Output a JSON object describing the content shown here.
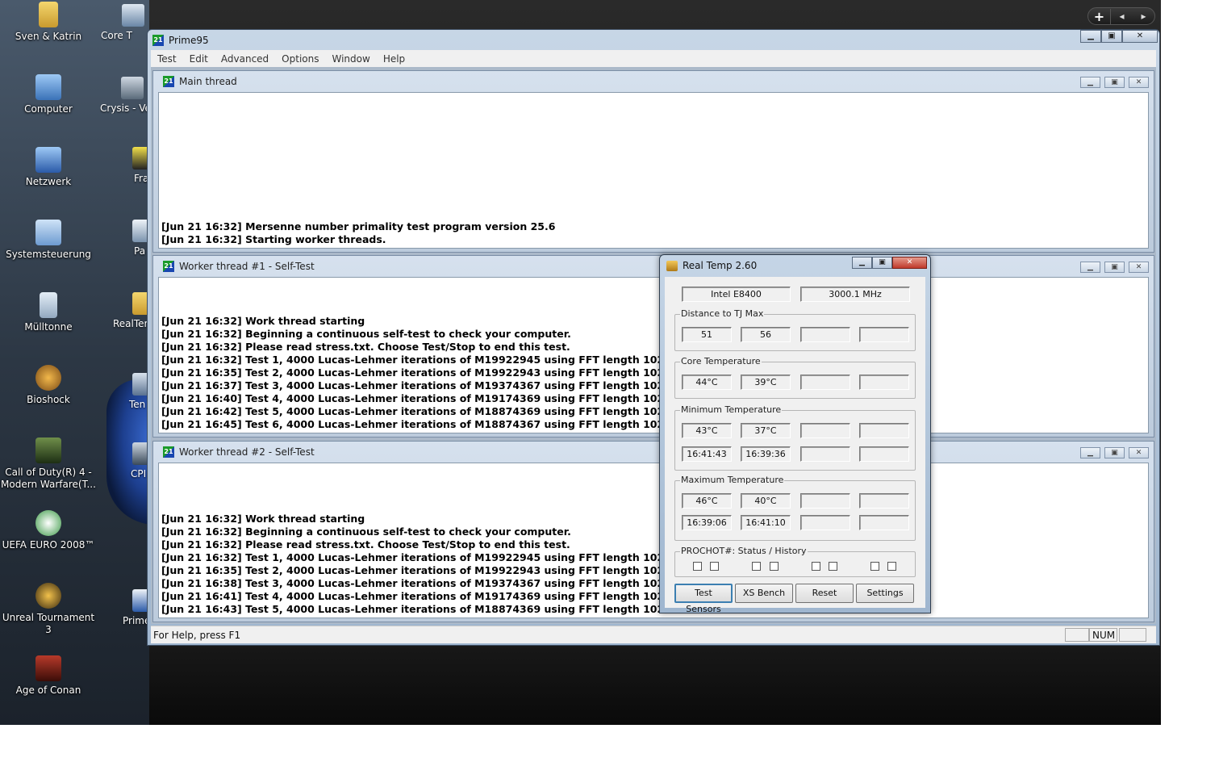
{
  "desktop": {
    "icons_left": [
      {
        "label": "Sven & Katrin"
      },
      {
        "label": "Computer"
      },
      {
        "label": "Netzwerk"
      },
      {
        "label": "Systemsteuerung"
      },
      {
        "label": "Mülltonne"
      },
      {
        "label": "Bioshock"
      },
      {
        "label": "Call of Duty(R) 4 -"
      },
      {
        "label": "Modern Warfare(T..."
      },
      {
        "label": "UEFA EURO 2008™"
      },
      {
        "label": "Unreal Tournament 3"
      },
      {
        "label": "Age of Conan"
      }
    ],
    "icons_right": [
      {
        "label": "Core T"
      },
      {
        "label": "Crysis - Ve"
      },
      {
        "label": "Fra"
      },
      {
        "label": "Pa"
      },
      {
        "label": "RealTer"
      },
      {
        "label": "Ten"
      },
      {
        "label": "CPI"
      },
      {
        "label": "Prime"
      }
    ],
    "sidebar_control": {
      "add": "+",
      "prev": "◂",
      "next": "▸"
    }
  },
  "prime95": {
    "title": "Prime95",
    "menu": [
      "Test",
      "Edit",
      "Advanced",
      "Options",
      "Window",
      "Help"
    ],
    "windows": [
      {
        "title": "Main thread",
        "lines": [
          "[Jun 21 16:32] Mersenne number primality test program version 25.6",
          "[Jun 21 16:32] Starting worker threads."
        ]
      },
      {
        "title": "Worker thread #1 - Self-Test",
        "lines": [
          "[Jun 21 16:32] Work thread starting",
          "[Jun 21 16:32] Beginning a continuous self-test to check your computer.",
          "[Jun 21 16:32] Please read stress.txt.  Choose Test/Stop to end this test.",
          "[Jun 21 16:32] Test 1, 4000 Lucas-Lehmer iterations of M19922945 using FFT length 1024K.",
          "[Jun 21 16:35] Test 2, 4000 Lucas-Lehmer iterations of M19922943 using FFT length 1024K.",
          "[Jun 21 16:37] Test 3, 4000 Lucas-Lehmer iterations of M19374367 using FFT length 1024K.",
          "[Jun 21 16:40] Test 4, 4000 Lucas-Lehmer iterations of M19174369 using FFT length 1024K.",
          "[Jun 21 16:42] Test 5, 4000 Lucas-Lehmer iterations of M18874369 using FFT length 1024K.",
          "[Jun 21 16:45] Test 6, 4000 Lucas-Lehmer iterations of M18874367 using FFT length 1024K."
        ]
      },
      {
        "title": "Worker thread #2 - Self-Test",
        "lines": [
          "[Jun 21 16:32] Work thread starting",
          "[Jun 21 16:32] Beginning a continuous self-test to check your computer.",
          "[Jun 21 16:32] Please read stress.txt.  Choose Test/Stop to end this test.",
          "[Jun 21 16:32] Test 1, 4000 Lucas-Lehmer iterations of M19922945 using FFT length 1024K.",
          "[Jun 21 16:35] Test 2, 4000 Lucas-Lehmer iterations of M19922943 using FFT length 1024K.",
          "[Jun 21 16:38] Test 3, 4000 Lucas-Lehmer iterations of M19374367 using FFT length 1024K.",
          "[Jun 21 16:41] Test 4, 4000 Lucas-Lehmer iterations of M19174369 using FFT length 1024K.",
          "[Jun 21 16:43] Test 5, 4000 Lucas-Lehmer iterations of M18874369 using FFT length 1024K."
        ]
      }
    ],
    "status": {
      "help": "For Help, press F1",
      "num": "NUM"
    }
  },
  "realtemp": {
    "title": "Real Temp 2.60",
    "cpu": "Intel E8400",
    "clock": "3000.1 MHz",
    "distance_label": "Distance to TJ Max",
    "distance": [
      "51",
      "56",
      "",
      ""
    ],
    "core_label": "Core Temperature",
    "core": [
      "44°C",
      "39°C",
      "",
      ""
    ],
    "min_label": "Minimum Temperature",
    "min_temp": [
      "43°C",
      "37°C",
      "",
      ""
    ],
    "min_time": [
      "16:41:43",
      "16:39:36",
      "",
      ""
    ],
    "max_label": "Maximum Temperature",
    "max_temp": [
      "46°C",
      "40°C",
      "",
      ""
    ],
    "max_time": [
      "16:39:06",
      "16:41:10",
      "",
      ""
    ],
    "prochot_label": "PROCHOT#:   Status / History",
    "buttons": {
      "test": "Test Sensors",
      "xs": "XS Bench",
      "reset": "Reset",
      "settings": "Settings"
    }
  }
}
